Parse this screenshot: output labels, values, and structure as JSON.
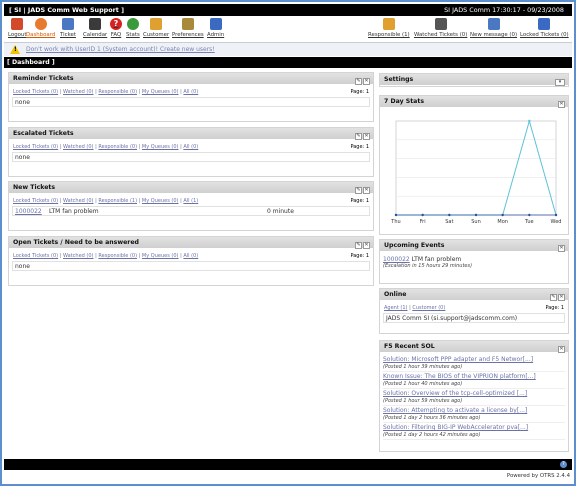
{
  "titlebar": {
    "title": "[ SI | JADS Comm Web Support ]",
    "right": "SI JADS Comm 17:30:17 - 09/23/2008"
  },
  "toolbar": {
    "items": [
      {
        "label": "Logout",
        "icon": "logout-icon",
        "color": "#d34a2a"
      },
      {
        "label": "Dashboard",
        "icon": "dashboard-icon",
        "color": "#e87a2e"
      },
      {
        "label": "Ticket",
        "icon": "ticket-icon",
        "color": "#4a78c2"
      },
      {
        "label": "Calendar",
        "icon": "calendar-icon",
        "color": "#3a3a3a"
      },
      {
        "label": "FAQ",
        "icon": "faq-icon",
        "color": "#d82020"
      },
      {
        "label": "Stats",
        "icon": "stats-icon",
        "color": "#3a9a3a"
      },
      {
        "label": "Customer",
        "icon": "customer-icon",
        "color": "#e0a030"
      },
      {
        "label": "Preferences",
        "icon": "preferences-icon",
        "color": "#a88a3a"
      },
      {
        "label": "Admin",
        "icon": "admin-icon",
        "color": "#3a6ac2"
      }
    ],
    "right_items": [
      {
        "label": "Responsible (1)",
        "icon": "responsible-icon",
        "color": "#e0a030"
      },
      {
        "label": "Watched Tickets (0)",
        "icon": "watched-icon",
        "color": "#555555"
      },
      {
        "label": "New message (0)",
        "icon": "message-icon",
        "color": "#4a78c2"
      },
      {
        "label": "Locked Tickets (0)",
        "icon": "locked-icon",
        "color": "#3a6ac2"
      }
    ]
  },
  "notice": {
    "text": "Don't work with UserID 1 (System account)! Create new users!"
  },
  "section": {
    "title": "[ Dashboard ]"
  },
  "filters": {
    "reminder": {
      "locked": "Locked Tickets (0)",
      "watched": "Watched (0)",
      "responsible": "Responsible (0)",
      "queues": "My Queues (0)",
      "all": "All (0)"
    },
    "escalated": {
      "locked": "Locked Tickets (0)",
      "watched": "Watched (0)",
      "responsible": "Responsible (0)",
      "queues": "My Queues (0)",
      "all": "All (0)"
    },
    "new": {
      "locked": "Locked Tickets (0)",
      "watched": "Watched (0)",
      "responsible": "Responsible (1)",
      "queues": "My Queues (0)",
      "all": "All (1)"
    },
    "open": {
      "locked": "Locked Tickets (0)",
      "watched": "Watched (0)",
      "responsible": "Responsible (0)",
      "queues": "My Queues (0)",
      "all": "All (0)"
    }
  },
  "panels": {
    "reminder": {
      "title": "Reminder Tickets",
      "page": "Page: 1",
      "empty": "none"
    },
    "escalated": {
      "title": "Escalated Tickets",
      "page": "Page: 1",
      "empty": "none"
    },
    "new": {
      "title": "New Tickets",
      "page": "Page: 1",
      "ticket_number": "1000022",
      "ticket_title": "LTM fan problem",
      "ticket_age": "0 minute"
    },
    "open": {
      "title": "Open Tickets / Need to be answered",
      "page": "Page: 1",
      "empty": "none"
    },
    "settings": {
      "title": "Settings"
    },
    "stats": {
      "title": "7 Day Stats"
    },
    "events": {
      "title": "Upcoming Events",
      "link": "1000022",
      "text": " LTM fan problem",
      "note": "(Escalation in 15 hours 29 minutes)"
    },
    "online": {
      "title": "Online",
      "agent": "Agent (1)",
      "sep": " | ",
      "customer": "Customer (0)",
      "page": "Page: 1",
      "user": "JADS Comm SI (si.support@jadscomm.com)"
    },
    "f5": {
      "title": "F5 Recent SOL",
      "items": [
        {
          "title": "Solution: Microsoft PPP adapter and F5 Networ[...]",
          "posted": "(Posted 1 hour 39 minutes ago)"
        },
        {
          "title": "Known Issue: The BIOS of the VIPRION platform[...]",
          "posted": "(Posted 1 hour 40 minutes ago)"
        },
        {
          "title": "Solution: Overview of the tcp-cell-optimized [...]",
          "posted": "(Posted 1 hour 59 minutes ago)"
        },
        {
          "title": "Solution: Attempting to activate a license by[...]",
          "posted": "(Posted 1 day 2 hours 36 minutes ago)"
        },
        {
          "title": "Solution: Filtering BIG-IP WebAccelerator pva[...]",
          "posted": "(Posted 1 day 2 hours 42 minutes ago)"
        }
      ]
    }
  },
  "footer": {
    "powered": "Powered by OTRS 2.4.4",
    "help": "?"
  },
  "chart_data": {
    "type": "line",
    "categories": [
      "Thu",
      "Fri",
      "Sat",
      "Sun",
      "Mon",
      "Tue",
      "Wed"
    ],
    "series": [
      {
        "values": [
          0,
          0,
          0,
          0,
          0,
          1,
          0
        ],
        "color": "#5cc2d6"
      },
      {
        "values": [
          0,
          0,
          0,
          0,
          0,
          0,
          0
        ],
        "color": "#2a4fa0"
      }
    ],
    "ylim": [
      0,
      1
    ],
    "grid": true,
    "title": "",
    "xlabel": "",
    "ylabel": ""
  }
}
